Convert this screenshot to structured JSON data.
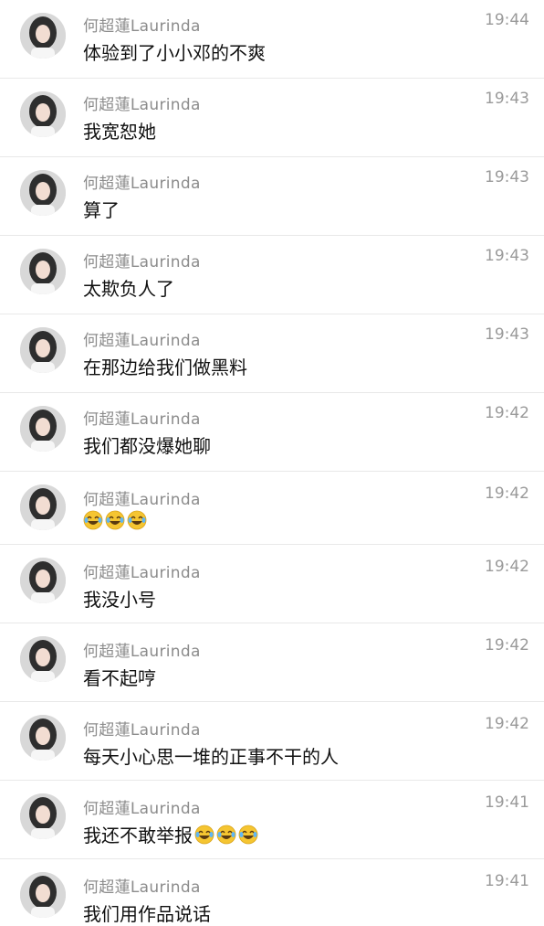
{
  "chat": {
    "messages": [
      {
        "name": "何超蓮Laurinda",
        "time": "19:44",
        "text": "体验到了小小邓的不爽",
        "emojis": []
      },
      {
        "name": "何超蓮Laurinda",
        "time": "19:43",
        "text": "我宽恕她",
        "emojis": []
      },
      {
        "name": "何超蓮Laurinda",
        "time": "19:43",
        "text": "算了",
        "emojis": []
      },
      {
        "name": "何超蓮Laurinda",
        "time": "19:43",
        "text": "太欺负人了",
        "emojis": []
      },
      {
        "name": "何超蓮Laurinda",
        "time": "19:43",
        "text": "在那边给我们做黑料",
        "emojis": []
      },
      {
        "name": "何超蓮Laurinda",
        "time": "19:42",
        "text": "我们都没爆她聊",
        "emojis": []
      },
      {
        "name": "何超蓮Laurinda",
        "time": "19:42",
        "text": "",
        "emojis": [
          "laughing-crying-emoji",
          "laughing-crying-emoji",
          "laughing-crying-emoji"
        ]
      },
      {
        "name": "何超蓮Laurinda",
        "time": "19:42",
        "text": "我没小号",
        "emojis": []
      },
      {
        "name": "何超蓮Laurinda",
        "time": "19:42",
        "text": "看不起哼",
        "emojis": []
      },
      {
        "name": "何超蓮Laurinda",
        "time": "19:42",
        "text": "每天小心思一堆的正事不干的人",
        "emojis": []
      },
      {
        "name": "何超蓮Laurinda",
        "time": "19:41",
        "text": "我还不敢举报",
        "emojis": [
          "laughing-crying-emoji",
          "laughing-crying-emoji",
          "laughing-crying-emoji"
        ]
      },
      {
        "name": "何超蓮Laurinda",
        "time": "19:41",
        "text": "我们用作品说话",
        "emojis": []
      }
    ]
  },
  "colors": {
    "name": "#8c8c8c",
    "time": "#9a9a9a",
    "text": "#111111",
    "divider": "#e8e8e8"
  }
}
